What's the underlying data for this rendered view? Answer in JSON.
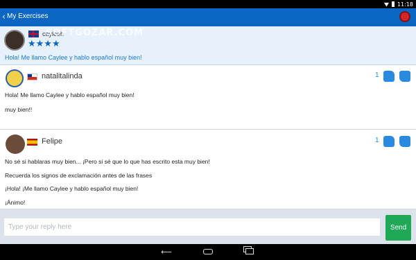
{
  "status_bar": {
    "time": "11:18"
  },
  "app_bar": {
    "back_glyph": "‹",
    "title": "My Exercises"
  },
  "post": {
    "username": "cayleeh",
    "stars": "★★★★",
    "text": "Hola! Me llamo Caylee y hablo español muy bien!"
  },
  "watermark": "SOFTGOZAR.COM",
  "comments": [
    {
      "name": "natalitalinda",
      "votes": "1",
      "lines": [
        "Hola! Me llamo Caylee y hablo español muy bien!",
        "muy bien!!"
      ]
    },
    {
      "name": "Felipe",
      "votes": "1",
      "lines": [
        "No sé si hablaras muy bien... ¡Pero si sé que lo que has escrito esta muy bien!",
        "Recuerda los signos de exclamación antes de las frases",
        "¡Hola! ¡Me llamo Caylee y hablo español muy bien!",
        "¡Ánimo!"
      ]
    }
  ],
  "reply": {
    "placeholder": "Type your reply here",
    "send_label": "Send"
  },
  "nav": {
    "back": "⟵",
    "home": "",
    "recent": ""
  },
  "colors": {
    "app_bar": "#0a66c2",
    "send": "#1fa855",
    "accent": "#2a8ae0"
  }
}
